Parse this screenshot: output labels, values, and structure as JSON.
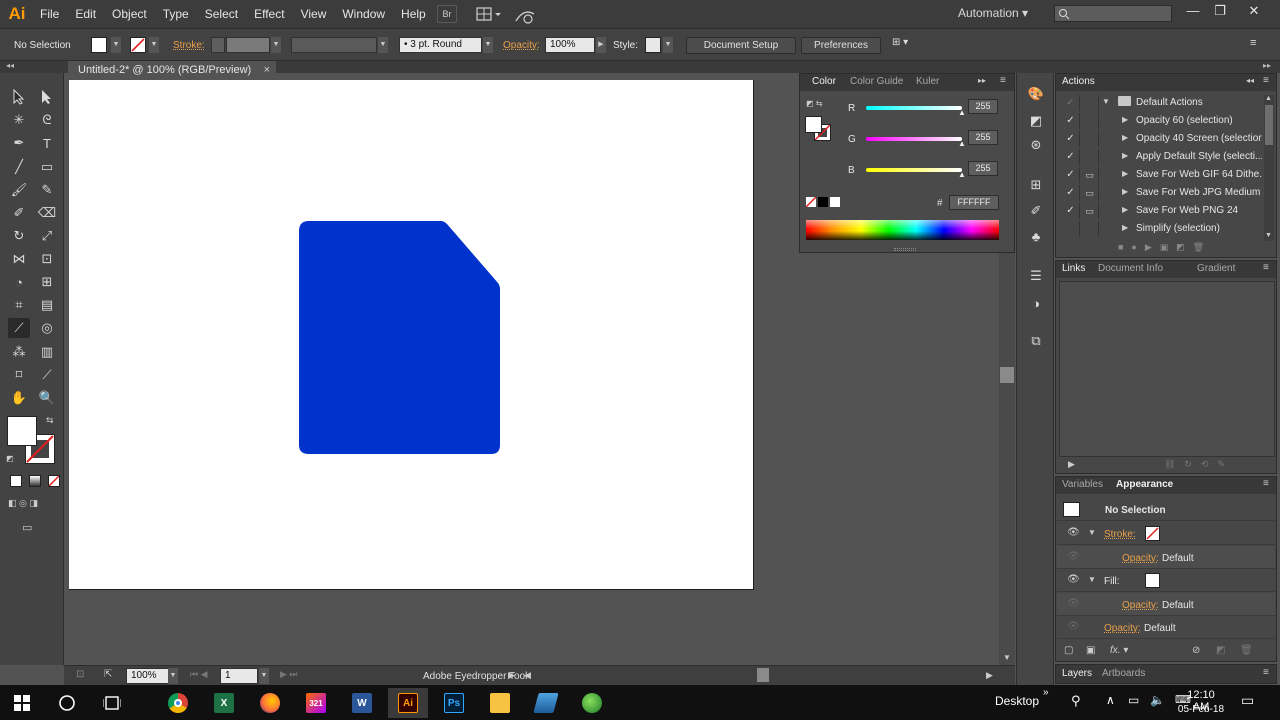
{
  "menubar": {
    "logo": "Ai",
    "items": [
      "File",
      "Edit",
      "Object",
      "Type",
      "Select",
      "Effect",
      "View",
      "Window",
      "Help"
    ],
    "bridge_label": "Br",
    "workspace": "Automation",
    "search_placeholder": "",
    "window_controls": [
      "—",
      "❐",
      "✕"
    ]
  },
  "controlbar": {
    "selection": "No Selection",
    "stroke_label": "Stroke:",
    "brush_label": "3 pt. Round",
    "opacity_label": "Opacity:",
    "opacity_value": "100%",
    "style_label": "Style:",
    "document_setup": "Document Setup",
    "preferences": "Preferences"
  },
  "document": {
    "tab_title": "Untitled-2* @ 100% (RGB/Preview)",
    "close": "×",
    "shape_color": "#0032cc"
  },
  "statusbar": {
    "zoom": "100%",
    "artboard_num": "1",
    "tool_name": "Adobe Eyedropper Tool"
  },
  "color_panel": {
    "tabs": [
      "Color",
      "Color Guide",
      "Kuler"
    ],
    "channels": [
      {
        "label": "R",
        "value": "255"
      },
      {
        "label": "G",
        "value": "255"
      },
      {
        "label": "B",
        "value": "255"
      }
    ],
    "hex_symbol": "#",
    "hex": "FFFFFF"
  },
  "actions_panel": {
    "title": "Actions",
    "set_name": "Default Actions",
    "items": [
      "Opacity 60 (selection)",
      "Opacity 40 Screen (selection)",
      "Apply Default Style (selecti...",
      "Save For Web GIF 64 Dithe...",
      "Save For Web JPG Medium",
      "Save For Web PNG 24",
      "Simplify (selection)"
    ]
  },
  "links_panel": {
    "tabs": [
      "Links",
      "Document Info",
      "Gradient"
    ]
  },
  "appearance_panel": {
    "tabs": [
      "Variables",
      "Appearance"
    ],
    "header": "No Selection",
    "stroke_label": "Stroke:",
    "fill_label": "Fill:",
    "opacity_label": "Opacity:",
    "default_label": "Default",
    "fx_label": "fx."
  },
  "layers_tabs": [
    "Layers",
    "Artboards"
  ],
  "taskbar": {
    "desktop_label": "Desktop",
    "time": "12:10 AM",
    "date": "05-Feb-18",
    "apps": [
      "chrome-icon",
      "excel-icon",
      "firefox-icon",
      "calendar-icon",
      "word-icon",
      "illustrator-icon",
      "photoshop-icon",
      "file-explorer-icon",
      "network-icon",
      "globe-icon"
    ]
  }
}
